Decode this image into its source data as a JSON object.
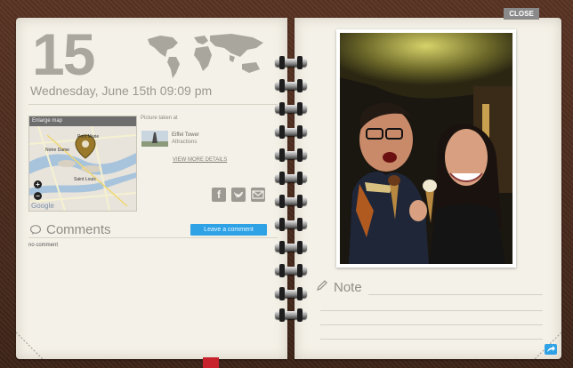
{
  "header": {
    "close_label": "CLOSE"
  },
  "entry": {
    "day": "15",
    "date_line": "Wednesday, June 15th 09:09 pm"
  },
  "map": {
    "title": "Enlarge map",
    "labels": [
      "Pont Marie",
      "Notre Dame",
      "Saint Louis"
    ],
    "zoom_in": "+",
    "zoom_out": "−",
    "provider": "Google"
  },
  "picture_info": {
    "taken_at_label": "Picture taken at",
    "location_name": "Eiffel Tower",
    "location_category": "Attractions",
    "view_more_label": "VIEW MORE DETAILS"
  },
  "share": {
    "facebook_icon": "facebook-icon",
    "twitter_icon": "twitter-icon",
    "email_icon": "email-icon"
  },
  "comments": {
    "title": "Comments",
    "leave_comment_label": "Leave a comment",
    "empty_text": "no comment"
  },
  "note": {
    "label": "Note"
  },
  "colors": {
    "accent": "#2fa2e6",
    "page": "#f4f1e8",
    "leather": "#4a2c20",
    "ribbon": "#c8232c"
  }
}
